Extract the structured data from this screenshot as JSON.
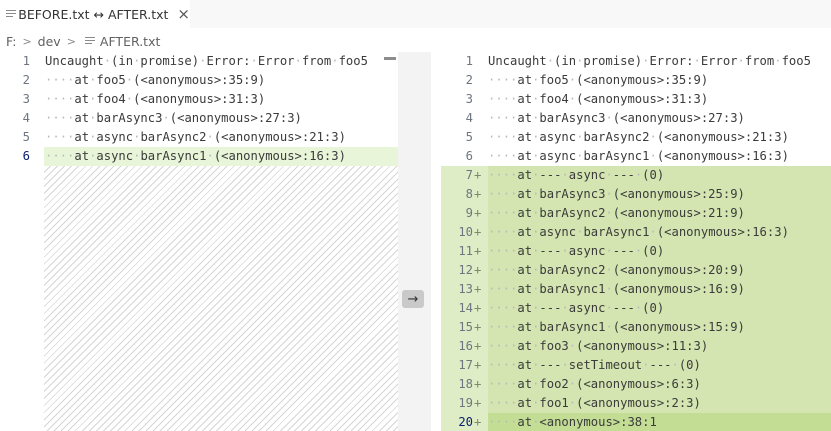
{
  "tab": {
    "title": "BEFORE.txt ↔ AFTER.txt",
    "close_icon": "×"
  },
  "breadcrumb": {
    "drive": "F:",
    "folder": "dev",
    "file": "AFTER.txt"
  },
  "compare_button": "→",
  "before": {
    "lines": [
      {
        "n": "1",
        "text": "Uncaught (in promise) Error: Error from foo5"
      },
      {
        "n": "2",
        "text": "    at foo5 (<anonymous>:35:9)"
      },
      {
        "n": "3",
        "text": "    at foo4 (<anonymous>:31:3)"
      },
      {
        "n": "4",
        "text": "    at barAsync3 (<anonymous>:27:3)"
      },
      {
        "n": "5",
        "text": "    at async barAsync2 (<anonymous>:21:3)"
      },
      {
        "n": "6",
        "text": "    at async barAsync1 (<anonymous>:16:3)"
      }
    ]
  },
  "after": {
    "lines": [
      {
        "n": "1",
        "text": "Uncaught (in promise) Error: Error from foo5",
        "added": false
      },
      {
        "n": "2",
        "text": "    at foo5 (<anonymous>:35:9)",
        "added": false
      },
      {
        "n": "3",
        "text": "    at foo4 (<anonymous>:31:3)",
        "added": false
      },
      {
        "n": "4",
        "text": "    at barAsync3 (<anonymous>:27:3)",
        "added": false
      },
      {
        "n": "5",
        "text": "    at async barAsync2 (<anonymous>:21:3)",
        "added": false
      },
      {
        "n": "6",
        "text": "    at async barAsync1 (<anonymous>:16:3)",
        "added": false
      },
      {
        "n": "7",
        "text": "    at --- async --- (0)",
        "added": true
      },
      {
        "n": "8",
        "text": "    at barAsync3 (<anonymous>:25:9)",
        "added": true
      },
      {
        "n": "9",
        "text": "    at barAsync2 (<anonymous>:21:9)",
        "added": true
      },
      {
        "n": "10",
        "text": "    at async barAsync1 (<anonymous>:16:3)",
        "added": true
      },
      {
        "n": "11",
        "text": "    at --- async --- (0)",
        "added": true
      },
      {
        "n": "12",
        "text": "    at barAsync2 (<anonymous>:20:9)",
        "added": true
      },
      {
        "n": "13",
        "text": "    at barAsync1 (<anonymous>:16:9)",
        "added": true
      },
      {
        "n": "14",
        "text": "    at --- async --- (0)",
        "added": true
      },
      {
        "n": "15",
        "text": "    at barAsync1 (<anonymous>:15:9)",
        "added": true
      },
      {
        "n": "16",
        "text": "    at foo3 (<anonymous>:11:3)",
        "added": true
      },
      {
        "n": "17",
        "text": "    at --- setTimeout --- (0)",
        "added": true
      },
      {
        "n": "18",
        "text": "    at foo2 (<anonymous>:6:3)",
        "added": true
      },
      {
        "n": "19",
        "text": "    at foo1 (<anonymous>:2:3)",
        "added": true
      },
      {
        "n": "20",
        "text": "    at <anonymous>:38:1",
        "added": true
      }
    ]
  },
  "colors": {
    "added_line": "#d4e5b1",
    "added_line_current": "#c3dd95",
    "modified_line_left": "#e8f5d9",
    "line_number_active": "#0b216f"
  }
}
